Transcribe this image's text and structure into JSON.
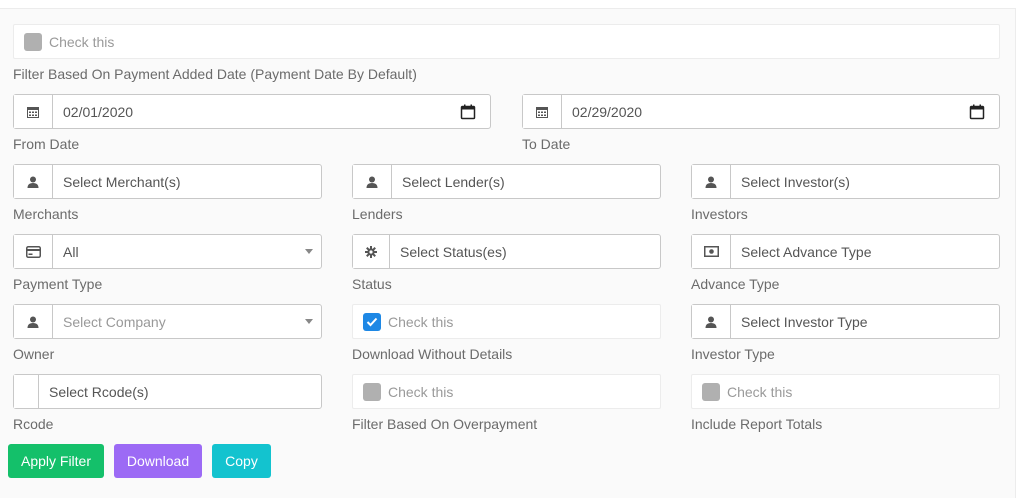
{
  "top_checkbox": {
    "label": "Check this",
    "checked": false
  },
  "date_filter_label": "Filter Based On Payment Added Date (Payment Date By Default)",
  "from_date": {
    "value": "02/01/2020",
    "label": "From Date"
  },
  "to_date": {
    "value": "02/29/2020",
    "label": "To Date"
  },
  "merchants": {
    "placeholder": "Select Merchant(s)",
    "label": "Merchants"
  },
  "lenders": {
    "placeholder": "Select Lender(s)",
    "label": "Lenders"
  },
  "investors": {
    "placeholder": "Select Investor(s)",
    "label": "Investors"
  },
  "payment_type": {
    "value": "All",
    "label": "Payment Type"
  },
  "status": {
    "placeholder": "Select Status(es)",
    "label": "Status"
  },
  "advance_type": {
    "placeholder": "Select Advance Type",
    "label": "Advance Type"
  },
  "owner": {
    "placeholder": "Select Company",
    "label": "Owner"
  },
  "download_without_details": {
    "checkbox_label": "Check this",
    "checked": true,
    "label": "Download Without Details"
  },
  "investor_type": {
    "placeholder": "Select Investor Type",
    "label": "Investor Type"
  },
  "rcode": {
    "placeholder": "Select Rcode(s)",
    "label": "Rcode"
  },
  "overpayment": {
    "checkbox_label": "Check this",
    "checked": false,
    "label": "Filter Based On Overpayment"
  },
  "report_totals": {
    "checkbox_label": "Check this",
    "checked": false,
    "label": "Include Report Totals"
  },
  "buttons": {
    "apply": "Apply Filter",
    "download": "Download",
    "copy": "Copy"
  },
  "colors": {
    "apply": "#14c06a",
    "download": "#9c6af5",
    "copy": "#13c3cf",
    "checked": "#1e88e5"
  }
}
